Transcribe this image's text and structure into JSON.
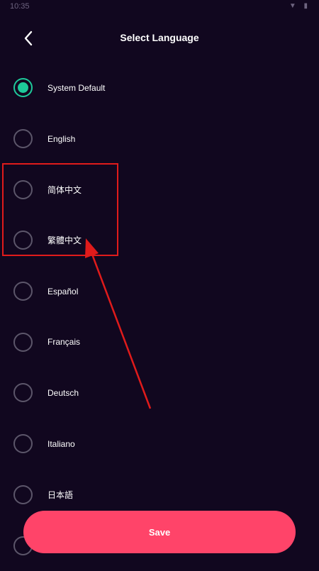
{
  "status_bar": {
    "time": "10:35",
    "icons": "▼ ▮"
  },
  "header": {
    "title": "Select Language"
  },
  "languages": [
    {
      "label": "System Default",
      "selected": true
    },
    {
      "label": "English",
      "selected": false
    },
    {
      "label": "简体中文",
      "selected": false
    },
    {
      "label": "繁體中文",
      "selected": false
    },
    {
      "label": "Español",
      "selected": false
    },
    {
      "label": "Français",
      "selected": false
    },
    {
      "label": "Deutsch",
      "selected": false
    },
    {
      "label": "Italiano",
      "selected": false
    },
    {
      "label": "日本語",
      "selected": false
    },
    {
      "label": "",
      "selected": false
    }
  ],
  "footer": {
    "save_label": "Save"
  },
  "colors": {
    "background": "#11071f",
    "accent_selected": "#1ec99a",
    "save_button": "#ff4469",
    "annotation": "#e01b1b"
  }
}
